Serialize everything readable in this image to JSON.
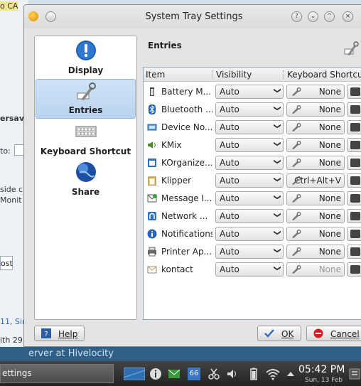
{
  "background_window": {
    "lines": [
      "o CA",
      "ersav",
      "to:",
      "side c",
      "Monit",
      "ost",
      "11, Sir",
      "ith 29"
    ],
    "strip_text": "erver at Hivelocity"
  },
  "window": {
    "title": "System Tray Settings",
    "buttons": [
      "?",
      "⌄",
      "^",
      "×"
    ]
  },
  "sidebar": {
    "items": [
      {
        "label": "Display",
        "icon": "info-icon",
        "active": false
      },
      {
        "label": "Entries",
        "icon": "wrench-icon",
        "active": true
      },
      {
        "label": "Keyboard Shortcut",
        "icon": "keyboard-icon",
        "active": false
      },
      {
        "label": "Share",
        "icon": "globe-icon",
        "active": false
      }
    ]
  },
  "main": {
    "section_title": "Entries",
    "columns": [
      "Item",
      "Visibility",
      "Keyboard Shortcut"
    ],
    "rows": [
      {
        "name": "Battery M...",
        "visibility": "Auto",
        "shortcut": "None",
        "icon": "battery-icon",
        "enabled": true
      },
      {
        "name": "Bluetooth ...",
        "visibility": "Auto",
        "shortcut": "None",
        "icon": "bluetooth-icon",
        "enabled": true
      },
      {
        "name": "Device No...",
        "visibility": "Auto",
        "shortcut": "None",
        "icon": "device-icon",
        "enabled": true
      },
      {
        "name": "KMix",
        "visibility": "Auto",
        "shortcut": "None",
        "icon": "speaker-icon",
        "enabled": true
      },
      {
        "name": "KOrganize...",
        "visibility": "Auto",
        "shortcut": "None",
        "icon": "calendar-icon",
        "enabled": true
      },
      {
        "name": "Klipper",
        "visibility": "Auto",
        "shortcut": "Ctrl+Alt+V",
        "icon": "clipboard-icon",
        "enabled": true
      },
      {
        "name": "Message I...",
        "visibility": "Auto",
        "shortcut": "None",
        "icon": "message-icon",
        "enabled": true
      },
      {
        "name": "Network ...",
        "visibility": "Auto",
        "shortcut": "None",
        "icon": "network-icon",
        "enabled": true
      },
      {
        "name": "Notifications",
        "visibility": "Auto",
        "shortcut": "None",
        "icon": "info-icon",
        "enabled": true
      },
      {
        "name": "Printer Ap...",
        "visibility": "Auto",
        "shortcut": "None",
        "icon": "printer-icon",
        "enabled": true
      },
      {
        "name": "kontact",
        "visibility": "Auto",
        "shortcut": "None",
        "icon": "kontact-icon",
        "enabled": false
      }
    ]
  },
  "footer": {
    "help_label": "Help",
    "ok_label": "OK",
    "cancel_label": "Cancel"
  },
  "taskbar": {
    "task_label": "ettings",
    "notification_count": "66",
    "clock": "05:42 PM",
    "date": "Sun, 13 Feb"
  }
}
